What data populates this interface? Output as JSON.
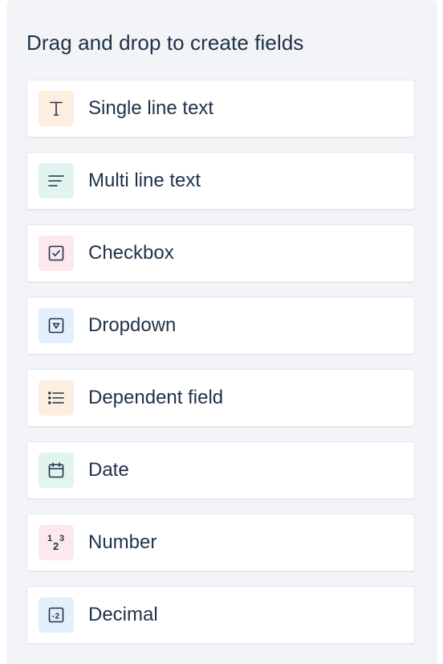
{
  "panel": {
    "heading": "Drag and drop to create fields"
  },
  "fields": [
    {
      "label": "Single line text",
      "icon": "text-t-icon",
      "icon_bg": "#fdeee0"
    },
    {
      "label": "Multi line text",
      "icon": "multiline-text-icon",
      "icon_bg": "#e2f4f0"
    },
    {
      "label": "Checkbox",
      "icon": "checkbox-icon",
      "icon_bg": "#fde8ed"
    },
    {
      "label": "Dropdown",
      "icon": "dropdown-icon",
      "icon_bg": "#e3effd"
    },
    {
      "label": "Dependent field",
      "icon": "list-icon",
      "icon_bg": "#fdeee0"
    },
    {
      "label": "Date",
      "icon": "calendar-icon",
      "icon_bg": "#e2f4f0"
    },
    {
      "label": "Number",
      "icon": "number-icon",
      "icon_bg": "#fde8ed",
      "icon_text": "123"
    },
    {
      "label": "Decimal",
      "icon": "decimal-icon",
      "icon_bg": "#e3effd",
      "icon_text": "·2"
    }
  ],
  "colors": {
    "panel_bg": "#f2f4f7",
    "text": "#1e3248",
    "card_border": "#e1e6ec"
  }
}
